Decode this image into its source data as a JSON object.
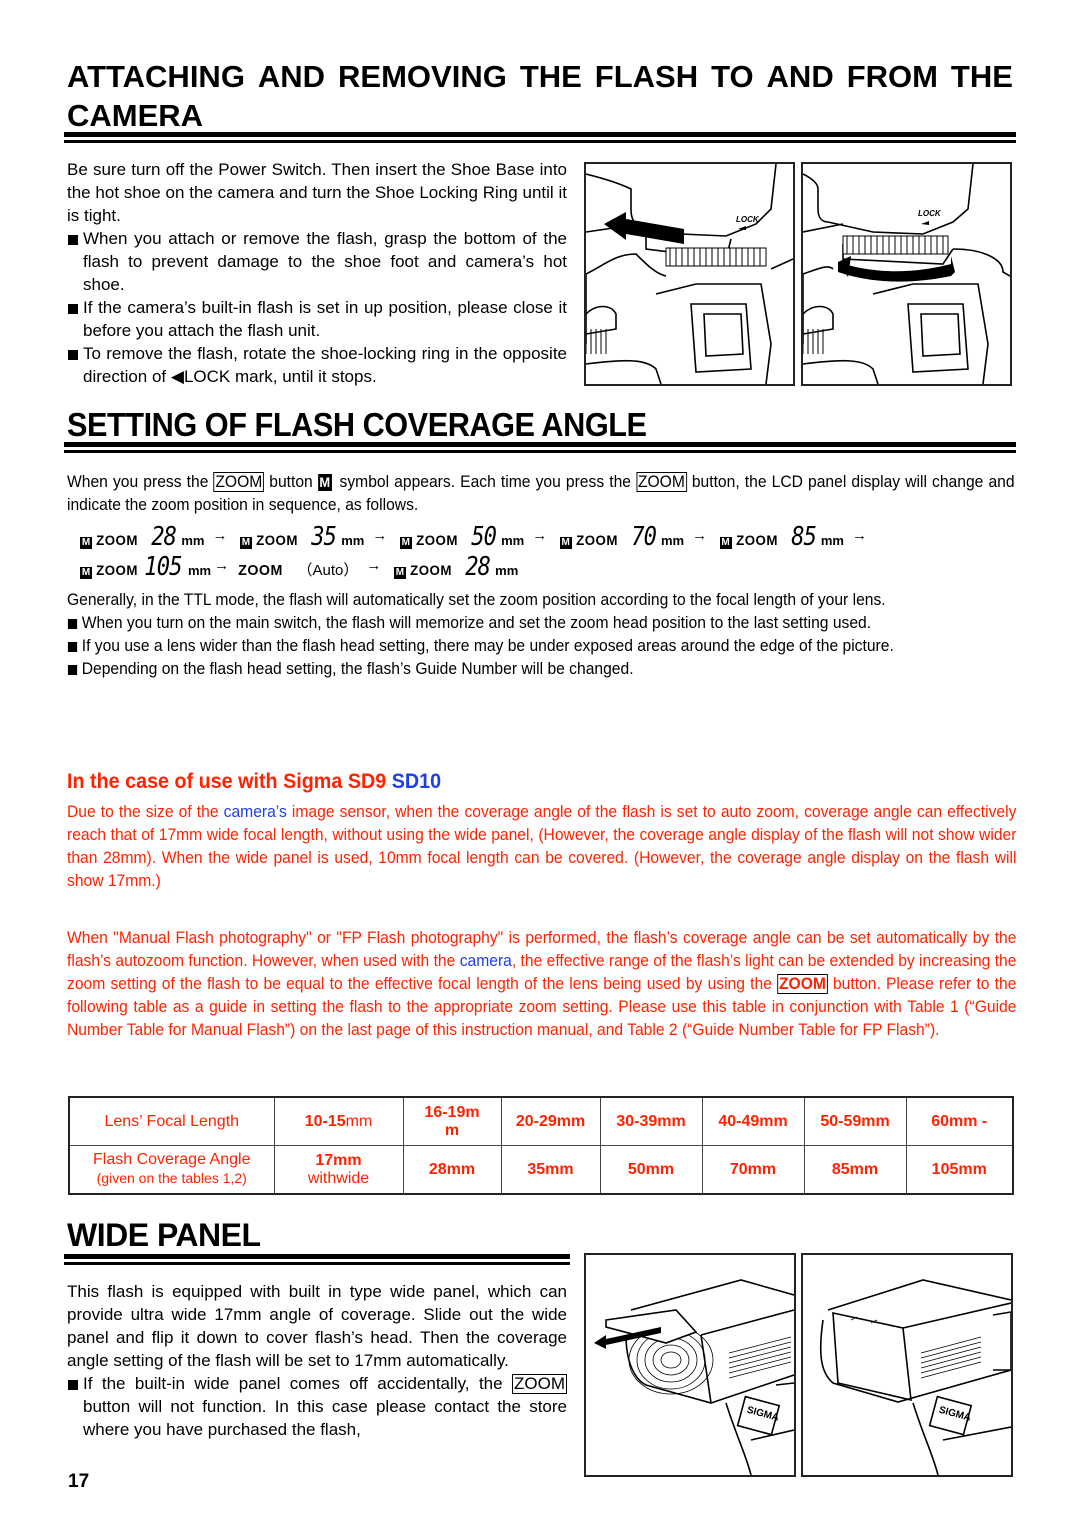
{
  "page_number": "17",
  "colors": {
    "text": "#000000",
    "accent_red": "#ff2200",
    "accent_blue": "#1d3fe8"
  },
  "section1": {
    "title_line1": [
      "ATTACHING",
      "AND",
      "REMOVING",
      "THE",
      "FLASH",
      "TO",
      "AND",
      "FROM",
      "THE"
    ],
    "title_line2": "CAMERA",
    "intro": "Be sure turn off the Power Switch. Then insert the Shoe Base into the hot shoe on the camera and turn the Shoe Locking Ring until it is tight.",
    "bullets": [
      "When you attach or remove the flash, grasp the bottom of the flash to prevent damage to the shoe foot and camera’s hot shoe.",
      "If the camera’s built-in flash is set in up position, please close it before you attach the flash unit.",
      "To remove the flash, rotate the shoe-locking ring in the opposite direction of ◀LOCK mark, until it stops."
    ],
    "illustrations": [
      {
        "name": "attach-flash-illustration",
        "label": "LOCK"
      },
      {
        "name": "rotate-ring-illustration",
        "label": "LOCK"
      }
    ]
  },
  "section2": {
    "title": "SETTING OF FLASH COVERAGE ANGLE",
    "intro_part1": "When you press the",
    "zoom_label": "ZOOM",
    "intro_part2": "button",
    "m_symbol": "M",
    "intro_part3": "symbol appears. Each time you press the",
    "intro_part4": "button, the LCD panel display will change and indicate the zoom position in sequence, as follows.",
    "sequence_row1": [
      {
        "m": "M",
        "zoom": "ZOOM",
        "value": "28",
        "unit": "mm"
      },
      {
        "m": "M",
        "zoom": "ZOOM",
        "value": "35",
        "unit": "mm"
      },
      {
        "m": "M",
        "zoom": "ZOOM",
        "value": "50",
        "unit": "mm"
      },
      {
        "m": "M",
        "zoom": "ZOOM",
        "value": "70",
        "unit": "mm"
      },
      {
        "m": "M",
        "zoom": "ZOOM",
        "value": "85",
        "unit": "mm"
      }
    ],
    "sequence_row2": {
      "item1": {
        "m": "M",
        "zoom": "ZOOM",
        "value": "105",
        "unit": "mm"
      },
      "item2": {
        "zoom": "ZOOM",
        "auto": "（Auto）"
      },
      "item3": {
        "m": "M",
        "zoom": "ZOOM",
        "value": "28",
        "unit": "mm"
      }
    },
    "arrow": "→",
    "general": "Generally, in the TTL mode, the flash will automatically set the zoom position according to the focal length of your lens.",
    "bullets": [
      "When you turn on the main switch, the flash will memorize and set the zoom head position to the last setting used.",
      "If you use a lens wider than the flash head setting, there may be under exposed areas around the edge of the picture.",
      "Depending on the flash head setting, the flash’s Guide Number will be changed."
    ],
    "sigma": {
      "heading_red": "In the case of use with Sigma SD9",
      "heading_blue": "SD10",
      "p1_a": "Due to the size of the",
      "p1_blue": "camera’s",
      "p1_b": "image sensor, when the coverage angle of the flash is set to auto zoom, coverage angle can effectively reach that of 17mm wide focal length, without using the wide panel, (However, the coverage angle display of the flash will not show wider than 28mm).  When the wide panel is used, 10mm focal length can be covered. (However, the coverage angle display on the flash will show 17mm.)",
      "p2_a": "When \"Manual Flash photography\" or \"FP Flash photography\" is performed, the flash’s coverage angle can be set automatically by the flash’s autozoom function. However, when used with the",
      "p2_blue": "camera",
      "p2_b": ", the effective range of the flash’s light can be extended by increasing the zoom setting of the flash to be equal to the effective focal length of the lens being used by using the",
      "p2_zoom": "ZOOM",
      "p2_c": "button. Please refer to the following table as a guide in setting the flash to the appropriate zoom setting.  Please use this table in conjunction with Table 1 (“Guide Number Table for Manual Flash”) on the last page of this instruction manual, and Table 2 (“Guide Number Table for FP Flash”)."
    },
    "table": {
      "row1_header": "Lens’ Focal Length",
      "row1_first_bold": "10-15",
      "row1_first_rest": "mm",
      "row1_second_a": "16-19m",
      "row1_second_b": "m",
      "row1": [
        "20-29mm",
        "30-39mm",
        "40-49mm",
        "50-59mm",
        "60mm -"
      ],
      "row2_header": "Flash Coverage Angle",
      "row2_header_note": "(given on the tables 1,2)",
      "row2_first_bold": "17mm",
      "row2_first_note": "withwide",
      "row2": [
        "28mm",
        "35mm",
        "50mm",
        "70mm",
        "85mm",
        "105mm"
      ]
    }
  },
  "section3": {
    "title": "WIDE PANEL",
    "intro": "This flash is equipped with built in type wide panel, which can provide ultra wide 17mm angle of coverage. Slide out the wide panel and flip it down to cover flash’s head. Then the coverage angle setting of the flash will be set to 17mm automatically.",
    "bullet_a": "If the built-in wide panel comes off accidentally, the",
    "bullet_zoom": "ZOOM",
    "bullet_b": "button will not function. In this case please contact the store where you have purchased the flash,",
    "illustrations": [
      {
        "name": "wide-panel-slide-illustration",
        "label": "SIGMA"
      },
      {
        "name": "wide-panel-flipped-illustration",
        "label": "SIGMA"
      }
    ]
  }
}
